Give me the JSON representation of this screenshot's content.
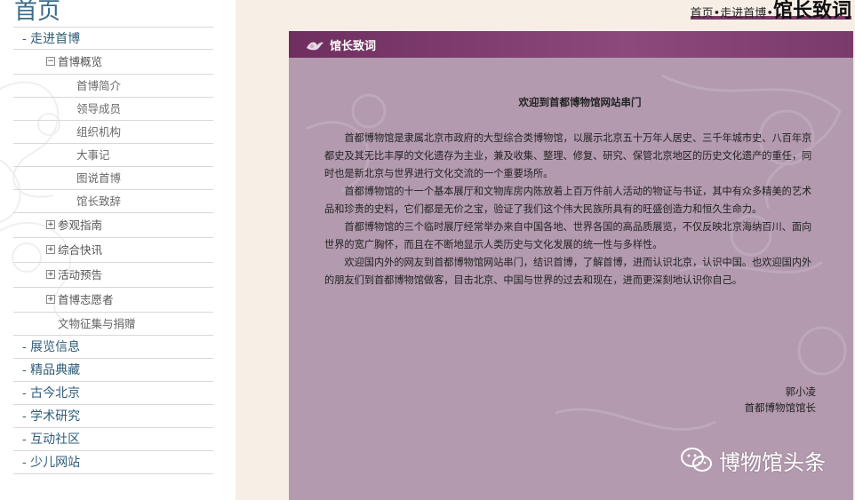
{
  "sidebar": {
    "home_title": "首页",
    "main_items": {
      "intro": "- 走进首博",
      "exhibition": "- 展览信息",
      "collection": "- 精品典藏",
      "beijing": "- 古今北京",
      "research": "- 学术研究",
      "community": "- 互动社区",
      "kids": "- 少儿网站"
    },
    "overview": {
      "toggle": "−",
      "label": "首博概览"
    },
    "overview_items": [
      "首博简介",
      "领导成员",
      "组织机构",
      "大事记",
      "图说首博",
      "馆长致辞"
    ],
    "collapsed": [
      {
        "toggle": "+",
        "label": "参观指南"
      },
      {
        "toggle": "+",
        "label": "综合快讯"
      },
      {
        "toggle": "+",
        "label": "活动预告"
      },
      {
        "toggle": "+",
        "label": "首博志愿者"
      }
    ],
    "donation": "文物征集与捐赠"
  },
  "breadcrumb": {
    "home": "首页",
    "sep1": "•",
    "section": "走进首博",
    "sep2": "•",
    "current": "馆长致词"
  },
  "panel": {
    "title": "馆长致词",
    "welcome": "欢迎到首都博物馆网站串门",
    "paragraphs": [
      "首都博物馆是隶属北京市政府的大型综合类博物馆，以展示北京五十万年人居史、三千年城市史、八百年京都史及其无比丰厚的文化遗存为主业，兼及收集、整理、修复、研究、保管北京地区的历史文化遗产的重任，同时也是新北京与世界进行文化交流的一个重要场所。",
      "首都博物馆的十一个基本展厅和文物库房内陈放着上百万件前人活动的物证与书证，其中有众多精美的艺术品和珍贵的史料，它们都是无价之宝，验证了我们这个伟大民族所具有的旺盛创造力和恒久生命力。",
      "首都博物馆的三个临时展厅经常举办来自中国各地、世界各国的高品质展览，不仅反映北京海纳百川、面向世界的宽广胸怀，而且在不断地显示人类历史与文化发展的统一性与多样性。",
      "欢迎国内外的网友到首都博物馆网站串门，结识首博，了解首博，进而认识北京，认识中国。也欢迎国内外的朋友们到首都博物馆做客，目击北京、中国与世界的过去和现在，进而更深刻地认识你自己。"
    ],
    "signature_name": "郭小凌",
    "signature_title": "首都博物馆馆长"
  },
  "watermark": {
    "text": "博物馆头条",
    "icon": "wechat-icon"
  },
  "colors": {
    "header": "#7b3a66",
    "panel": "#b39aaf",
    "page": "#f7efe6",
    "link": "#2f5d78"
  }
}
